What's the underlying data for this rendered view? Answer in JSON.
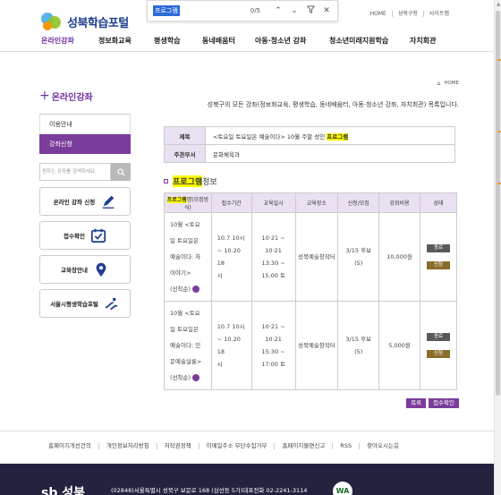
{
  "findbar": {
    "term": "프로그램",
    "count": "0/5"
  },
  "brand": {
    "name": "성북학습포털"
  },
  "topnav": [
    "HOME",
    "성북구청",
    "사이트맵"
  ],
  "mainnav": [
    {
      "label": "온라인강좌",
      "active": true
    },
    {
      "label": "정보화교육"
    },
    {
      "label": "평생학습"
    },
    {
      "label": "동네배움터"
    },
    {
      "label": "아동·청소년 강좌"
    },
    {
      "label": "청소년미래지원학습"
    },
    {
      "label": "자치회관"
    }
  ],
  "sidebar": {
    "title": "온라인강좌",
    "menu": [
      {
        "label": "이용안내"
      },
      {
        "label": "강좌신청",
        "active": true
      }
    ],
    "search_placeholder": "원하는 강좌를 검색하세요.",
    "quick": [
      "온라인 강좌 신청",
      "접수확인",
      "교육장안내",
      "서울시평생학습포털"
    ]
  },
  "content": {
    "crumb": "HOME",
    "intro": "성북구의 모든 강좌(정보화교육, 평생학습, 동네배움터, 아동·청소년 강좌, 자치회관) 목록입니다.",
    "info": {
      "title_label": "제목",
      "title_pre": "<토요일 토요일은 예술이다> 10월 주말 성인 ",
      "title_hl": "프로그램",
      "dept_label": "주관부서",
      "dept_value": "문화체육과"
    },
    "section_hl": "프로그램",
    "section_rest": " 정보",
    "table": {
      "headers": [
        "프로그램명(모집방식)",
        "접수기간",
        "교육일시",
        "교육장소",
        "신청/모집",
        "강좌비용",
        "상태"
      ],
      "header_hl": "프로그램",
      "header_hl_rest": "명(모집방식)",
      "rows": [
        {
          "name_lines": [
            "10월 <토요",
            "일 토요일은",
            "예술이다: 차",
            "이야기>",
            "(선착순)"
          ],
          "period_lines": [
            "10.7 10시",
            "~ 10.20 18",
            "시"
          ],
          "time_lines": [
            "10·21 ~",
            "10·21",
            "13:30 ~",
            "15:00 토"
          ],
          "place": "성북예술창작터",
          "apply_lines": [
            "3/15 후보",
            "(5)"
          ],
          "fee": "10,000원",
          "status": [
            "종료",
            "신청"
          ]
        },
        {
          "name_lines": [
            "10월 <토요",
            "일 토요일은",
            "예술이다: 인",
            "문예술살롱>",
            "(선착순)"
          ],
          "period_lines": [
            "10.7 10시",
            "~ 10.20 18",
            "시"
          ],
          "time_lines": [
            "10·21 ~",
            "10·21",
            "15:30 ~",
            "17:00 토"
          ],
          "place": "성북예술창작터",
          "apply_lines": [
            "3/15 후보",
            "(5)"
          ],
          "fee": "5,000원",
          "status": [
            "종료",
            "신청"
          ]
        }
      ]
    },
    "buttons": [
      "목록",
      "접수확인"
    ]
  },
  "footer": {
    "links": [
      "홈페이지개선건의",
      "개인정보처리방침",
      "저작권정책",
      "이메일주소 무단수집거부",
      "홈페이지불편신고",
      "RSS",
      "찾아오시는길"
    ],
    "logo": "sb 성북",
    "address": "(02848)서울특별시 성북구 보문로 168 (삼선동 5가)대표전화 02-2241-3114",
    "badge": "WA"
  },
  "colors": {
    "accent": "#7b3d9c",
    "header_cell": "#e9e0f1",
    "highlight": "#ffff00",
    "footer_bg": "#23233f"
  }
}
